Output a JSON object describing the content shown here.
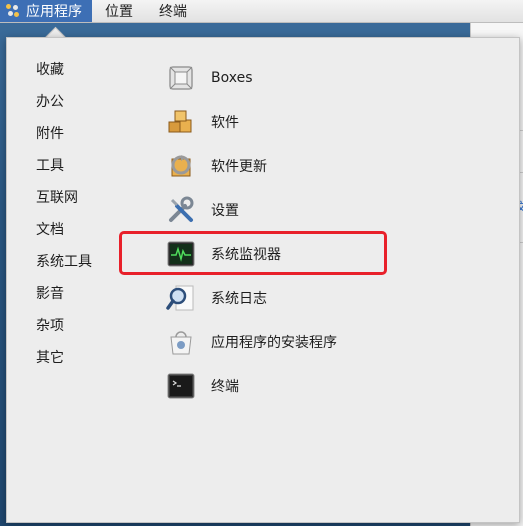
{
  "topbar": {
    "applications": "应用程序",
    "places": "位置",
    "terminal": "终端"
  },
  "categories": [
    "收藏",
    "办公",
    "附件",
    "工具",
    "互联网",
    "文档",
    "系统工具",
    "影音",
    "杂项",
    "其它"
  ],
  "apps": [
    {
      "label": "Boxes",
      "icon": "boxes-icon"
    },
    {
      "label": "软件",
      "icon": "software-icon"
    },
    {
      "label": "软件更新",
      "icon": "software-update-icon"
    },
    {
      "label": "设置",
      "icon": "settings-tools-icon"
    },
    {
      "label": "系统监视器",
      "icon": "system-monitor-icon"
    },
    {
      "label": "系统日志",
      "icon": "system-log-icon"
    },
    {
      "label": "应用程序的安装程序",
      "icon": "app-installer-icon"
    },
    {
      "label": "终端",
      "icon": "terminal-icon"
    }
  ],
  "background_window": {
    "partial_text": "文"
  },
  "colors": {
    "highlight": "#e8202a",
    "menu_active": "#3d6fb5"
  }
}
